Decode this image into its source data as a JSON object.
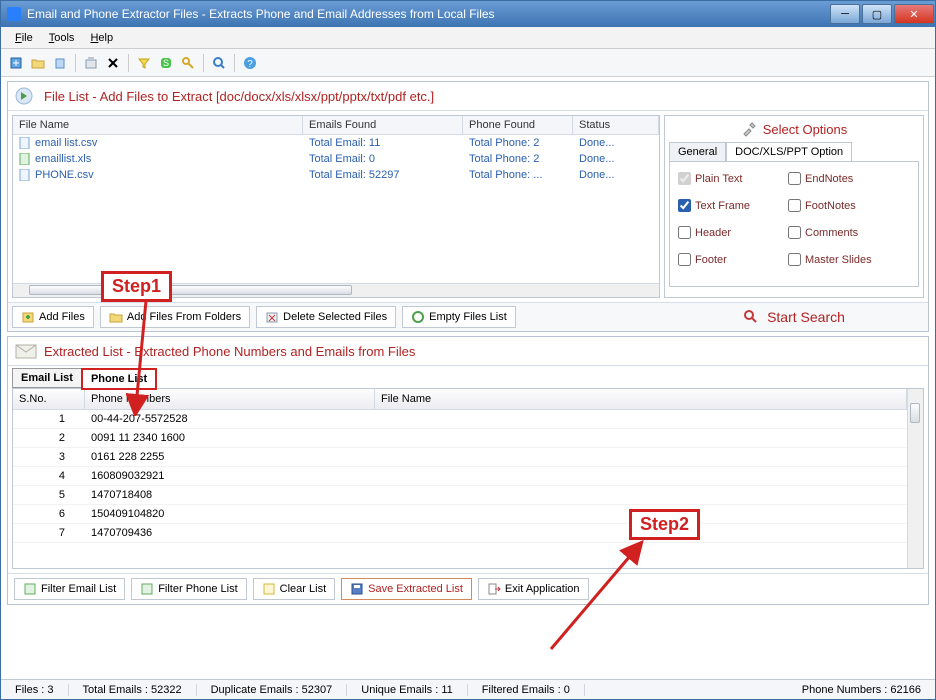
{
  "window": {
    "title": "Email and Phone Extractor Files  -  Extracts Phone and Email Addresses from Local Files"
  },
  "menu": {
    "file": "File",
    "tools": "Tools",
    "help": "Help"
  },
  "file_panel": {
    "title": "File List - Add Files to Extract  [doc/docx/xls/xlsx/ppt/pptx/txt/pdf etc.]",
    "columns": {
      "name": "File Name",
      "emails": "Emails Found",
      "phone": "Phone Found",
      "status": "Status"
    },
    "rows": [
      {
        "name": "email list.csv",
        "emails": "Total Email: 11",
        "phone": "Total Phone: 2",
        "status": "Done..."
      },
      {
        "name": "emaillist.xls",
        "emails": "Total Email: 0",
        "phone": "Total Phone: 2",
        "status": "Done..."
      },
      {
        "name": "PHONE.csv",
        "emails": "Total Email: 52297",
        "phone": "Total Phone: ...",
        "status": "Done..."
      }
    ],
    "actions": {
      "add": "Add Files",
      "addfolder": "Add Files From Folders",
      "delete": "Delete Selected Files",
      "empty": "Empty Files List"
    }
  },
  "options": {
    "title": "Select Options",
    "tabs": {
      "general": "General",
      "doc": "DOC/XLS/PPT Option"
    },
    "items": {
      "plaintext": "Plain Text",
      "endnotes": "EndNotes",
      "textframe": "Text Frame",
      "footnotes": "FootNotes",
      "header": "Header",
      "comments": "Comments",
      "footer": "Footer",
      "masterslides": "Master Slides"
    },
    "start": "Start Search"
  },
  "extracted_panel": {
    "title": "Extracted List - Extracted Phone Numbers and Emails from Files",
    "tabs": {
      "email": "Email List",
      "phone": "Phone List"
    },
    "columns": {
      "sno": "S.No.",
      "phone": "Phone Numbers",
      "file": "File Name"
    },
    "rows": [
      {
        "sno": "1",
        "phone": "00-44-207-5572528"
      },
      {
        "sno": "2",
        "phone": "0091 11 2340 1600"
      },
      {
        "sno": "3",
        "phone": "0161 228 2255"
      },
      {
        "sno": "4",
        "phone": "160809032921"
      },
      {
        "sno": "5",
        "phone": "1470718408"
      },
      {
        "sno": "6",
        "phone": "150409104820"
      },
      {
        "sno": "7",
        "phone": "1470709436"
      }
    ]
  },
  "bottom_actions": {
    "filteremail": "Filter Email List",
    "filterphone": "Filter Phone List",
    "clear": "Clear List",
    "save": "Save Extracted List",
    "exit": "Exit Application"
  },
  "statusbar": {
    "files": "Files :  3",
    "total": "Total Emails :  52322",
    "dup": "Duplicate Emails :  52307",
    "unique": "Unique Emails :  11",
    "filtered": "Filtered Emails :  0",
    "phone": "Phone Numbers :  62166"
  },
  "annotations": {
    "step1": "Step1",
    "step2": "Step2"
  }
}
